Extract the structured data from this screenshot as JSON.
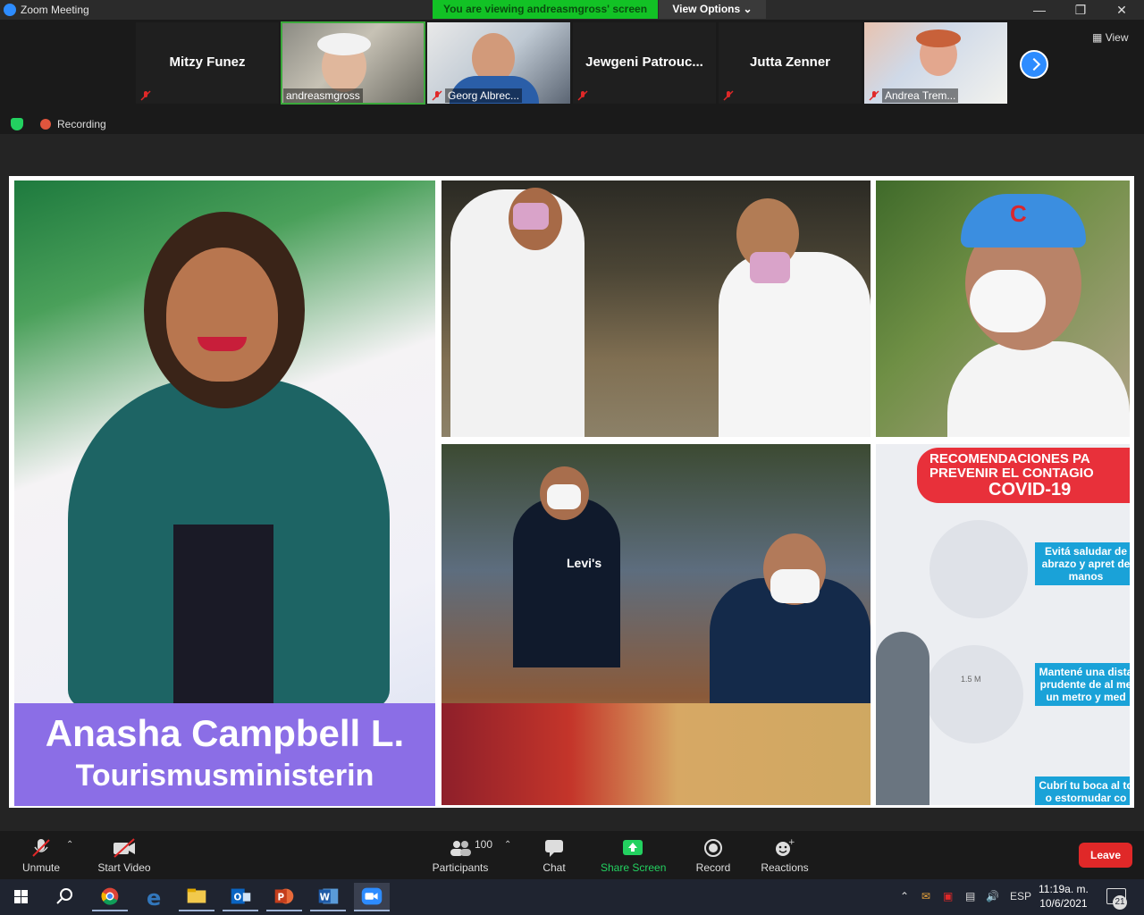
{
  "window": {
    "title": "Zoom Meeting"
  },
  "share_banner": "You are viewing andreasmgross' screen",
  "view_options": "View Options",
  "view_button": "View",
  "thumbnails": [
    {
      "name": "Mitzy Funez",
      "type": "text"
    },
    {
      "name": "andreasmgross",
      "type": "video"
    },
    {
      "name": "Georg Albrec...",
      "type": "video"
    },
    {
      "name": "Jewgeni  Patrouc...",
      "type": "text"
    },
    {
      "name": "Jutta Zenner",
      "type": "text"
    },
    {
      "name": "Andrea Trem...",
      "type": "video"
    }
  ],
  "status": {
    "recording": "Recording"
  },
  "slide": {
    "person_name": "Anasha Campbell L.",
    "person_role": "Tourismusministerin",
    "covid_title_1": "RECOMENDACIONES PA",
    "covid_title_2": "PREVENIR EL CONTAGIO",
    "covid_title_3": "COVID-19",
    "rec1": "Evitá saludar de abrazo y apret de manos",
    "rec2": "Mantené una dista prudente de al me un metro y med",
    "rec3": "Cubrí tu boca al to o estornudar co",
    "distance": "1.5 M",
    "cap_letters": "C",
    "shirt_brand": "Levi's"
  },
  "toolbar": {
    "unmute": "Unmute",
    "start_video": "Start Video",
    "participants": "Participants",
    "participants_count": "100",
    "chat": "Chat",
    "share_screen": "Share Screen",
    "record": "Record",
    "reactions": "Reactions",
    "leave": "Leave"
  },
  "taskbar": {
    "language": "ESP",
    "time": "11:19a. m.",
    "date": "10/6/2021",
    "notifications": "21"
  },
  "colors": {
    "zoom_blue": "#2d8cff",
    "share_green": "#12c225",
    "leave_red": "#e02828",
    "caption_purple": "#8b6ee6",
    "covid_red": "#e8303a"
  },
  "icons": [
    "zoom-icon",
    "minimize-icon",
    "maximize-icon",
    "close-icon",
    "muted-mic-icon",
    "next-page-icon",
    "view-grid-icon",
    "shield-icon",
    "record-dot-icon",
    "video-off-icon",
    "participants-icon",
    "chat-icon",
    "share-screen-icon",
    "record-icon",
    "reactions-icon",
    "windows-start-icon",
    "search-icon",
    "chrome-icon",
    "edge-icon",
    "file-explorer-icon",
    "outlook-icon",
    "powerpoint-icon",
    "word-icon",
    "zoom-taskbar-icon"
  ]
}
